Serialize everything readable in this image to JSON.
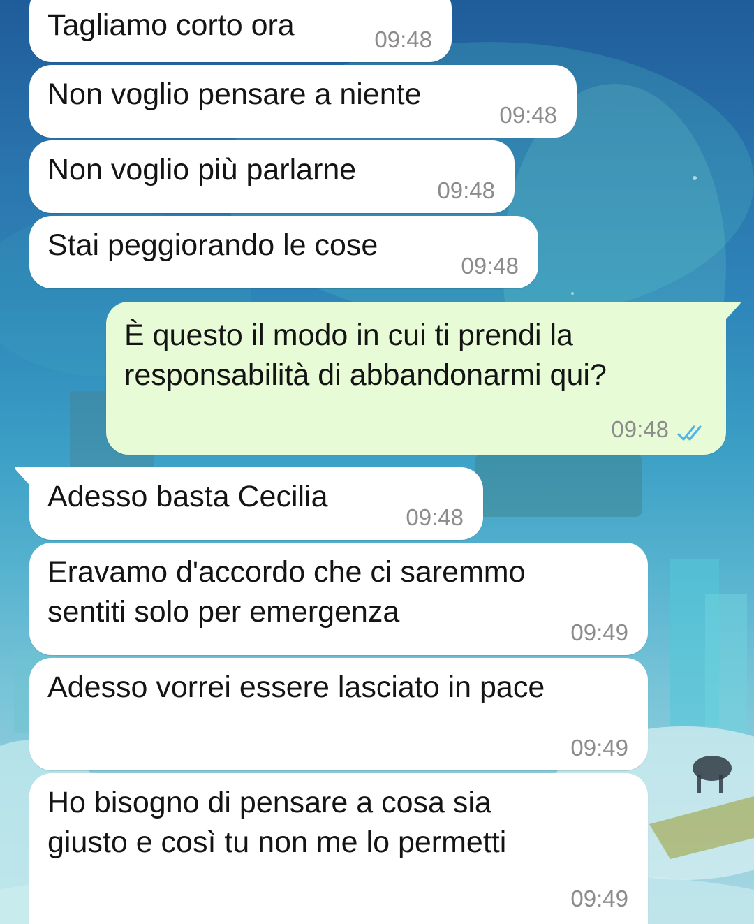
{
  "colors": {
    "incoming_bubble": "#ffffff",
    "outgoing_bubble": "#e7fcd6",
    "timestamp": "#8c8c8c",
    "read_ticks": "#4fb6ec",
    "wallpaper_top": "#1f5c9a",
    "wallpaper_bottom": "#a8d8e3"
  },
  "messages": [
    {
      "direction": "incoming",
      "text": "Tagliamo corto ora",
      "time": "09:48"
    },
    {
      "direction": "incoming",
      "text": "Non voglio pensare a niente",
      "time": "09:48"
    },
    {
      "direction": "incoming",
      "text": "Non voglio più parlarne",
      "time": "09:48"
    },
    {
      "direction": "incoming",
      "text": "Stai peggiorando le cose",
      "time": "09:48"
    },
    {
      "direction": "outgoing",
      "text": "È questo il modo in cui ti prendi la\nresponsabilità di abbandonarmi qui?",
      "time": "09:48",
      "status_icon": "double-check-read-icon"
    },
    {
      "direction": "incoming",
      "text": "Adesso basta Cecilia",
      "time": "09:48"
    },
    {
      "direction": "incoming",
      "text": "Eravamo d'accordo che ci saremmo\nsentiti solo per emergenza",
      "time": "09:49"
    },
    {
      "direction": "incoming",
      "text": "Adesso vorrei essere lasciato in pace",
      "time": "09:49"
    },
    {
      "direction": "incoming",
      "text": "Ho bisogno di pensare a cosa sia\ngiusto e così tu non me lo permetti",
      "time": "09:49"
    }
  ]
}
